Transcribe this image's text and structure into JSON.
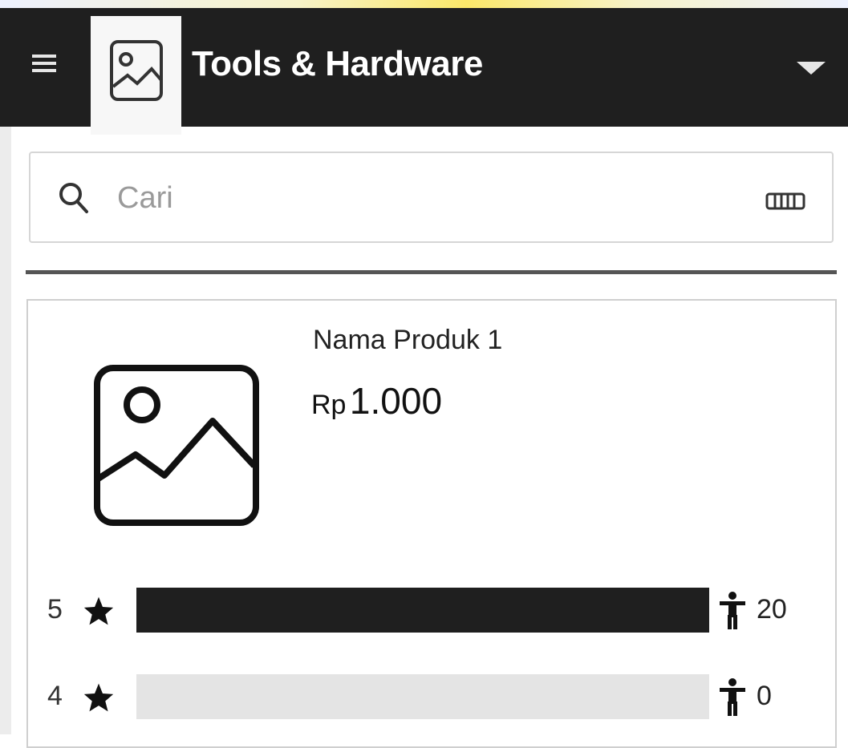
{
  "appbar": {
    "title": "Tools & Hardware",
    "menu_icon": "hamburger-menu-icon",
    "logo_icon": "image-placeholder-icon",
    "dropdown_icon": "triangle-down-icon"
  },
  "search": {
    "placeholder": "Cari",
    "search_icon": "magnifier-icon",
    "keyboard_icon": "keyboard-icon"
  },
  "product": {
    "name": "Nama Produk 1",
    "price_currency": "Rp",
    "price_value": "1.000",
    "image_icon": "image-placeholder-icon",
    "ratings": [
      {
        "stars": "5",
        "count": "20",
        "fill_fraction": 1.0
      },
      {
        "stars": "4",
        "count": "0",
        "fill_fraction": 0.0
      }
    ]
  },
  "colors": {
    "appbar_bg": "#1f1f1f",
    "bar_filled": "#1f1f1f",
    "bar_empty": "#e4e4e4"
  }
}
